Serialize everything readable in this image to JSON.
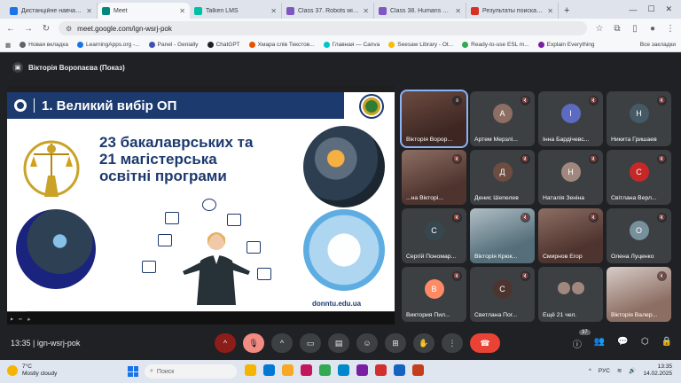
{
  "browser": {
    "tabs": [
      {
        "title": "Дистанційне навчання з д",
        "color": "#1a73e8",
        "active": false
      },
      {
        "title": "Meet",
        "color": "#00897b",
        "active": true
      },
      {
        "title": "Talken LMS",
        "color": "#00bfa5",
        "active": false
      },
      {
        "title": "Class 37. Robots will teach",
        "color": "#7e57c2",
        "active": false
      },
      {
        "title": "Class 38. Humans need hu",
        "color": "#7e57c2",
        "active": false
      },
      {
        "title": "Результаты поиска - vikto",
        "color": "#d93025",
        "active": false
      }
    ],
    "address": "meet.google.com/ign-wsrj-pok",
    "bookmarks": [
      {
        "label": "Новая вкладка",
        "color": "#5f6368"
      },
      {
        "label": "LearningApps.org -...",
        "color": "#1a73e8"
      },
      {
        "label": "Panel - Genially",
        "color": "#3f51b5"
      },
      {
        "label": "ChatGPT",
        "color": "#202124"
      },
      {
        "label": "Хмара слів Текстов...",
        "color": "#e65100"
      },
      {
        "label": "Главная — Canva",
        "color": "#00c4cc"
      },
      {
        "label": "Seesaw Library - Ot...",
        "color": "#fbbc04"
      },
      {
        "label": "Ready-to-use ESL m...",
        "color": "#34a853"
      },
      {
        "label": "Explain Everything",
        "color": "#7b1fa2"
      }
    ],
    "all_bookmarks": "Все закладки"
  },
  "meet": {
    "presenter": "Вікторія Воропаєва (Показ)",
    "slide": {
      "title": "1. Великий вибір ОП",
      "headline_1": "23 бакалаврських та",
      "headline_2": "21 магістерська",
      "headline_3": "освітні програми",
      "site": "donntu.edu.ua"
    },
    "video_progress": 0.05,
    "participants": [
      {
        "name": "Вікторія Ворор...",
        "style": "cam",
        "speaking": true
      },
      {
        "name": "Артем Мерзлі...",
        "style": "avatar",
        "initial": "А",
        "color": "#8d6e63"
      },
      {
        "name": "Інна Бардічевс...",
        "style": "avatar",
        "initial": "І",
        "color": "#5c6bc0"
      },
      {
        "name": "Никита Гришаев",
        "style": "avatar",
        "initial": "Н",
        "color": "#455a64"
      },
      {
        "name": "...на Вікторі...",
        "style": "cam2"
      },
      {
        "name": "Денис Шепелев",
        "style": "avatar",
        "initial": "Д",
        "color": "#6d4c41"
      },
      {
        "name": "Наталія Зеніна",
        "style": "avatar",
        "initial": "Н",
        "color": "#a1887f"
      },
      {
        "name": "Світлана Верл...",
        "style": "avatar",
        "initial": "С",
        "color": "#c62828"
      },
      {
        "name": "Сергій Пономар...",
        "style": "avatar",
        "initial": "С",
        "color": "#37474f"
      },
      {
        "name": "Вікторія Крюк...",
        "style": "cam3"
      },
      {
        "name": "Смирнов Егор",
        "style": "cam2"
      },
      {
        "name": "Олена Луценко",
        "style": "avatar",
        "initial": "О",
        "color": "#78909c"
      },
      {
        "name": "Виктория Пил...",
        "style": "avatar",
        "initial": "В",
        "color": "#ff8a65"
      },
      {
        "name": "Светлана Пог...",
        "style": "avatar",
        "initial": "С",
        "color": "#4e342e"
      },
      {
        "name": "Ещё 21 чел.",
        "style": "more"
      },
      {
        "name": "Вікторія Валер...",
        "style": "cam4"
      }
    ],
    "meeting_time": "13:35",
    "meeting_code": "ign-wsrj-pok",
    "people_count": "37"
  },
  "taskbar": {
    "temp": "7°C",
    "weather": "Mostly cloudy",
    "search": "Поиск",
    "lang": "РУС",
    "time": "13:35",
    "date": "14.02.2025"
  }
}
